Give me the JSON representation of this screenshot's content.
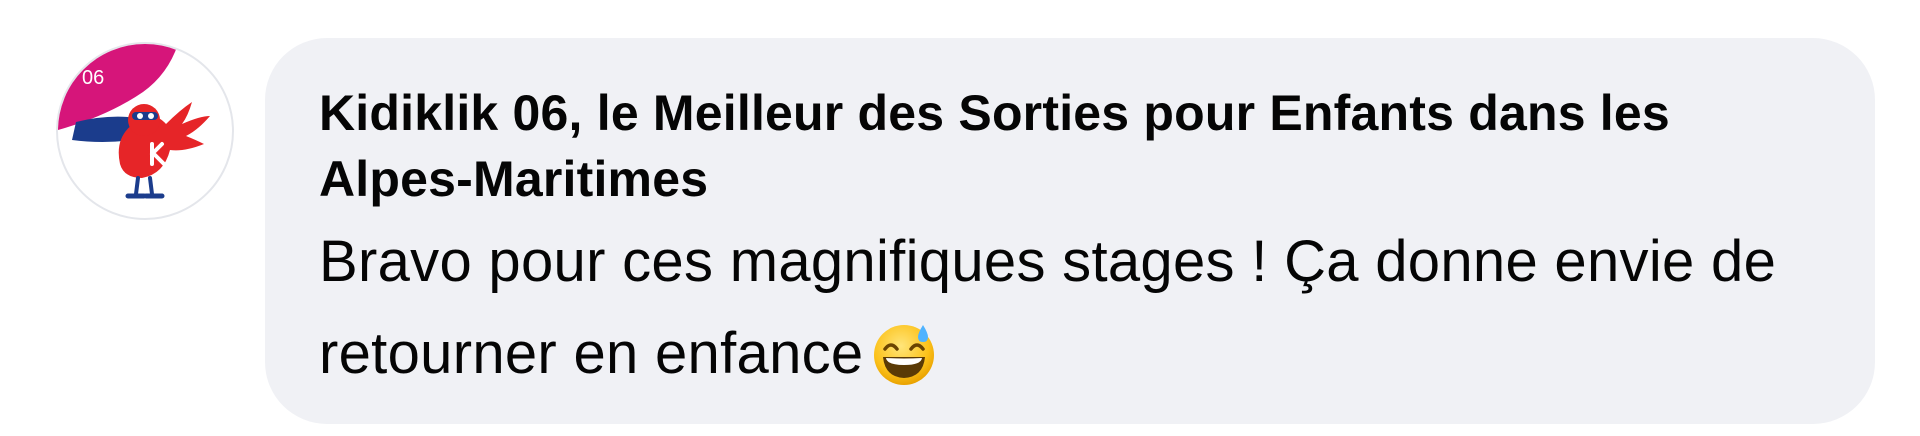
{
  "comment": {
    "avatar": {
      "badge_text": "06",
      "icon": "kidiklik-bird-logo",
      "colors": {
        "badge": "#d6157a",
        "bird": "#e62528",
        "cape": "#1b3c8c"
      }
    },
    "author": "Kidiklik 06, le Meilleur des Sorties pour Enfants dans les Alpes-Maritimes",
    "message": "Bravo pour ces magnifiques stages ! Ça donne envie de retourner en enfance",
    "emoji": "grinning-face-with-sweat-icon",
    "colors": {
      "bubble_background": "#f0f1f5",
      "text": "#050505"
    }
  }
}
